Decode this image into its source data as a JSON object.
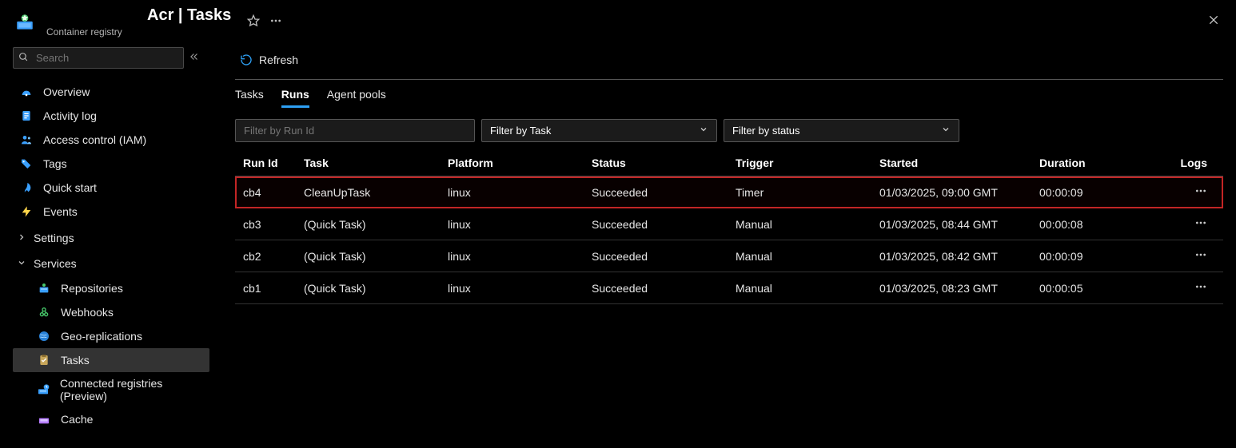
{
  "header": {
    "title_suffix": "Acr | Tasks",
    "subtitle": "Container registry"
  },
  "sidebar": {
    "search_placeholder": "Search",
    "items": [
      {
        "icon": "overview-icon",
        "label": "Overview"
      },
      {
        "icon": "activity-log-icon",
        "label": "Activity log"
      },
      {
        "icon": "iam-icon",
        "label": "Access control (IAM)"
      },
      {
        "icon": "tags-icon",
        "label": "Tags"
      },
      {
        "icon": "quickstart-icon",
        "label": "Quick start"
      },
      {
        "icon": "events-icon",
        "label": "Events"
      }
    ],
    "settings_label": "Settings",
    "services_label": "Services",
    "services": [
      {
        "icon": "repositories-icon",
        "label": "Repositories"
      },
      {
        "icon": "webhooks-icon",
        "label": "Webhooks"
      },
      {
        "icon": "georep-icon",
        "label": "Geo-replications"
      },
      {
        "icon": "tasks-icon",
        "label": "Tasks",
        "active": true
      },
      {
        "icon": "connected-icon",
        "label": "Connected registries (Preview)"
      },
      {
        "icon": "cache-icon",
        "label": "Cache"
      }
    ]
  },
  "commands": {
    "refresh": "Refresh"
  },
  "tabs": [
    {
      "label": "Tasks",
      "active": false
    },
    {
      "label": "Runs",
      "active": true
    },
    {
      "label": "Agent pools",
      "active": false
    }
  ],
  "filters": {
    "run_id_placeholder": "Filter by Run Id",
    "task_label": "Filter by Task",
    "status_label": "Filter by status"
  },
  "table": {
    "columns": [
      "Run Id",
      "Task",
      "Platform",
      "Status",
      "Trigger",
      "Started",
      "Duration",
      "Logs"
    ],
    "rows": [
      {
        "run_id": "cb4",
        "task": "CleanUpTask",
        "platform": "linux",
        "status": "Succeeded",
        "trigger": "Timer",
        "started": "01/03/2025, 09:00 GMT",
        "duration": "00:00:09",
        "highlight": true
      },
      {
        "run_id": "cb3",
        "task": "(Quick Task)",
        "platform": "linux",
        "status": "Succeeded",
        "trigger": "Manual",
        "started": "01/03/2025, 08:44 GMT",
        "duration": "00:00:08",
        "highlight": false
      },
      {
        "run_id": "cb2",
        "task": "(Quick Task)",
        "platform": "linux",
        "status": "Succeeded",
        "trigger": "Manual",
        "started": "01/03/2025, 08:42 GMT",
        "duration": "00:00:09",
        "highlight": false
      },
      {
        "run_id": "cb1",
        "task": "(Quick Task)",
        "platform": "linux",
        "status": "Succeeded",
        "trigger": "Manual",
        "started": "01/03/2025, 08:23 GMT",
        "duration": "00:00:05",
        "highlight": false
      }
    ]
  }
}
